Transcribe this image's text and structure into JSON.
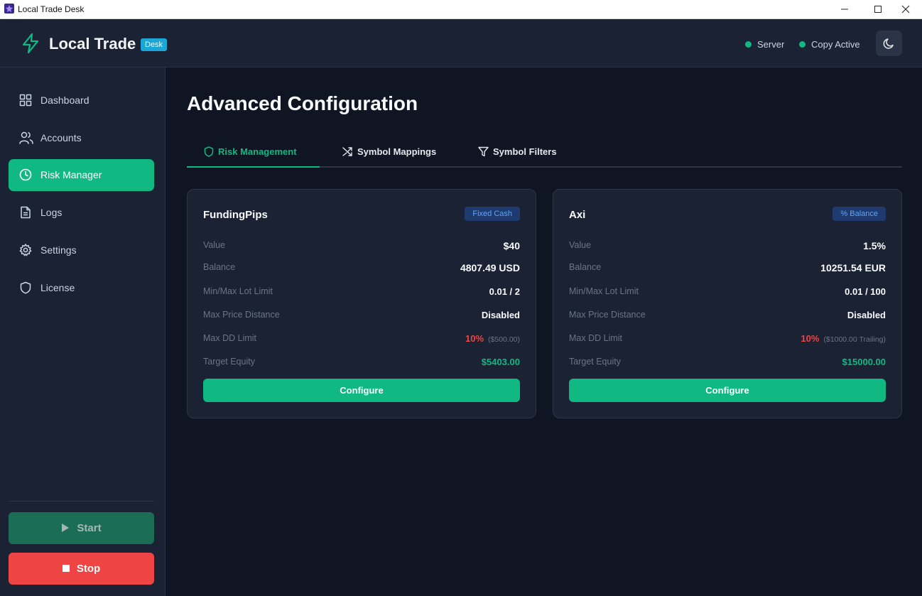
{
  "window": {
    "title": "Local Trade Desk"
  },
  "header": {
    "brand": "Local Trade",
    "badge": "Desk",
    "status_server": "Server",
    "status_copy": "Copy Active",
    "accent": "#10b981"
  },
  "sidebar": {
    "items": [
      {
        "label": "Dashboard",
        "icon": "grid-icon"
      },
      {
        "label": "Accounts",
        "icon": "users-icon"
      },
      {
        "label": "Risk Manager",
        "icon": "clock-icon",
        "active": true
      },
      {
        "label": "Logs",
        "icon": "document-icon"
      },
      {
        "label": "Settings",
        "icon": "gear-icon"
      },
      {
        "label": "License",
        "icon": "shield-icon"
      }
    ],
    "start_label": "Start",
    "stop_label": "Stop"
  },
  "main": {
    "title": "Advanced Configuration",
    "tabs": [
      {
        "label": "Risk Management",
        "icon": "shield-icon",
        "active": true
      },
      {
        "label": "Symbol Mappings",
        "icon": "shuffle-icon"
      },
      {
        "label": "Symbol Filters",
        "icon": "filter-icon"
      }
    ],
    "cards": [
      {
        "name": "FundingPips",
        "badge": "Fixed Cash",
        "rows": {
          "value_label": "Value",
          "value": "$40",
          "balance_label": "Balance",
          "balance": "4807.49 USD",
          "lot_label": "Min/Max Lot Limit",
          "lot": "0.01 / 2",
          "price_label": "Max Price Distance",
          "price": "Disabled",
          "dd_label": "Max DD Limit",
          "dd_pct": "10%",
          "dd_detail": "($500.00)",
          "target_label": "Target Equity",
          "target": "$5403.00"
        },
        "button": "Configure"
      },
      {
        "name": "Axi",
        "badge": "% Balance",
        "rows": {
          "value_label": "Value",
          "value": "1.5%",
          "balance_label": "Balance",
          "balance": "10251.54 EUR",
          "lot_label": "Min/Max Lot Limit",
          "lot": "0.01 / 100",
          "price_label": "Max Price Distance",
          "price": "Disabled",
          "dd_label": "Max DD Limit",
          "dd_pct": "10%",
          "dd_detail": "($1000.00 Trailing)",
          "target_label": "Target Equity",
          "target": "$15000.00"
        },
        "button": "Configure"
      }
    ]
  }
}
